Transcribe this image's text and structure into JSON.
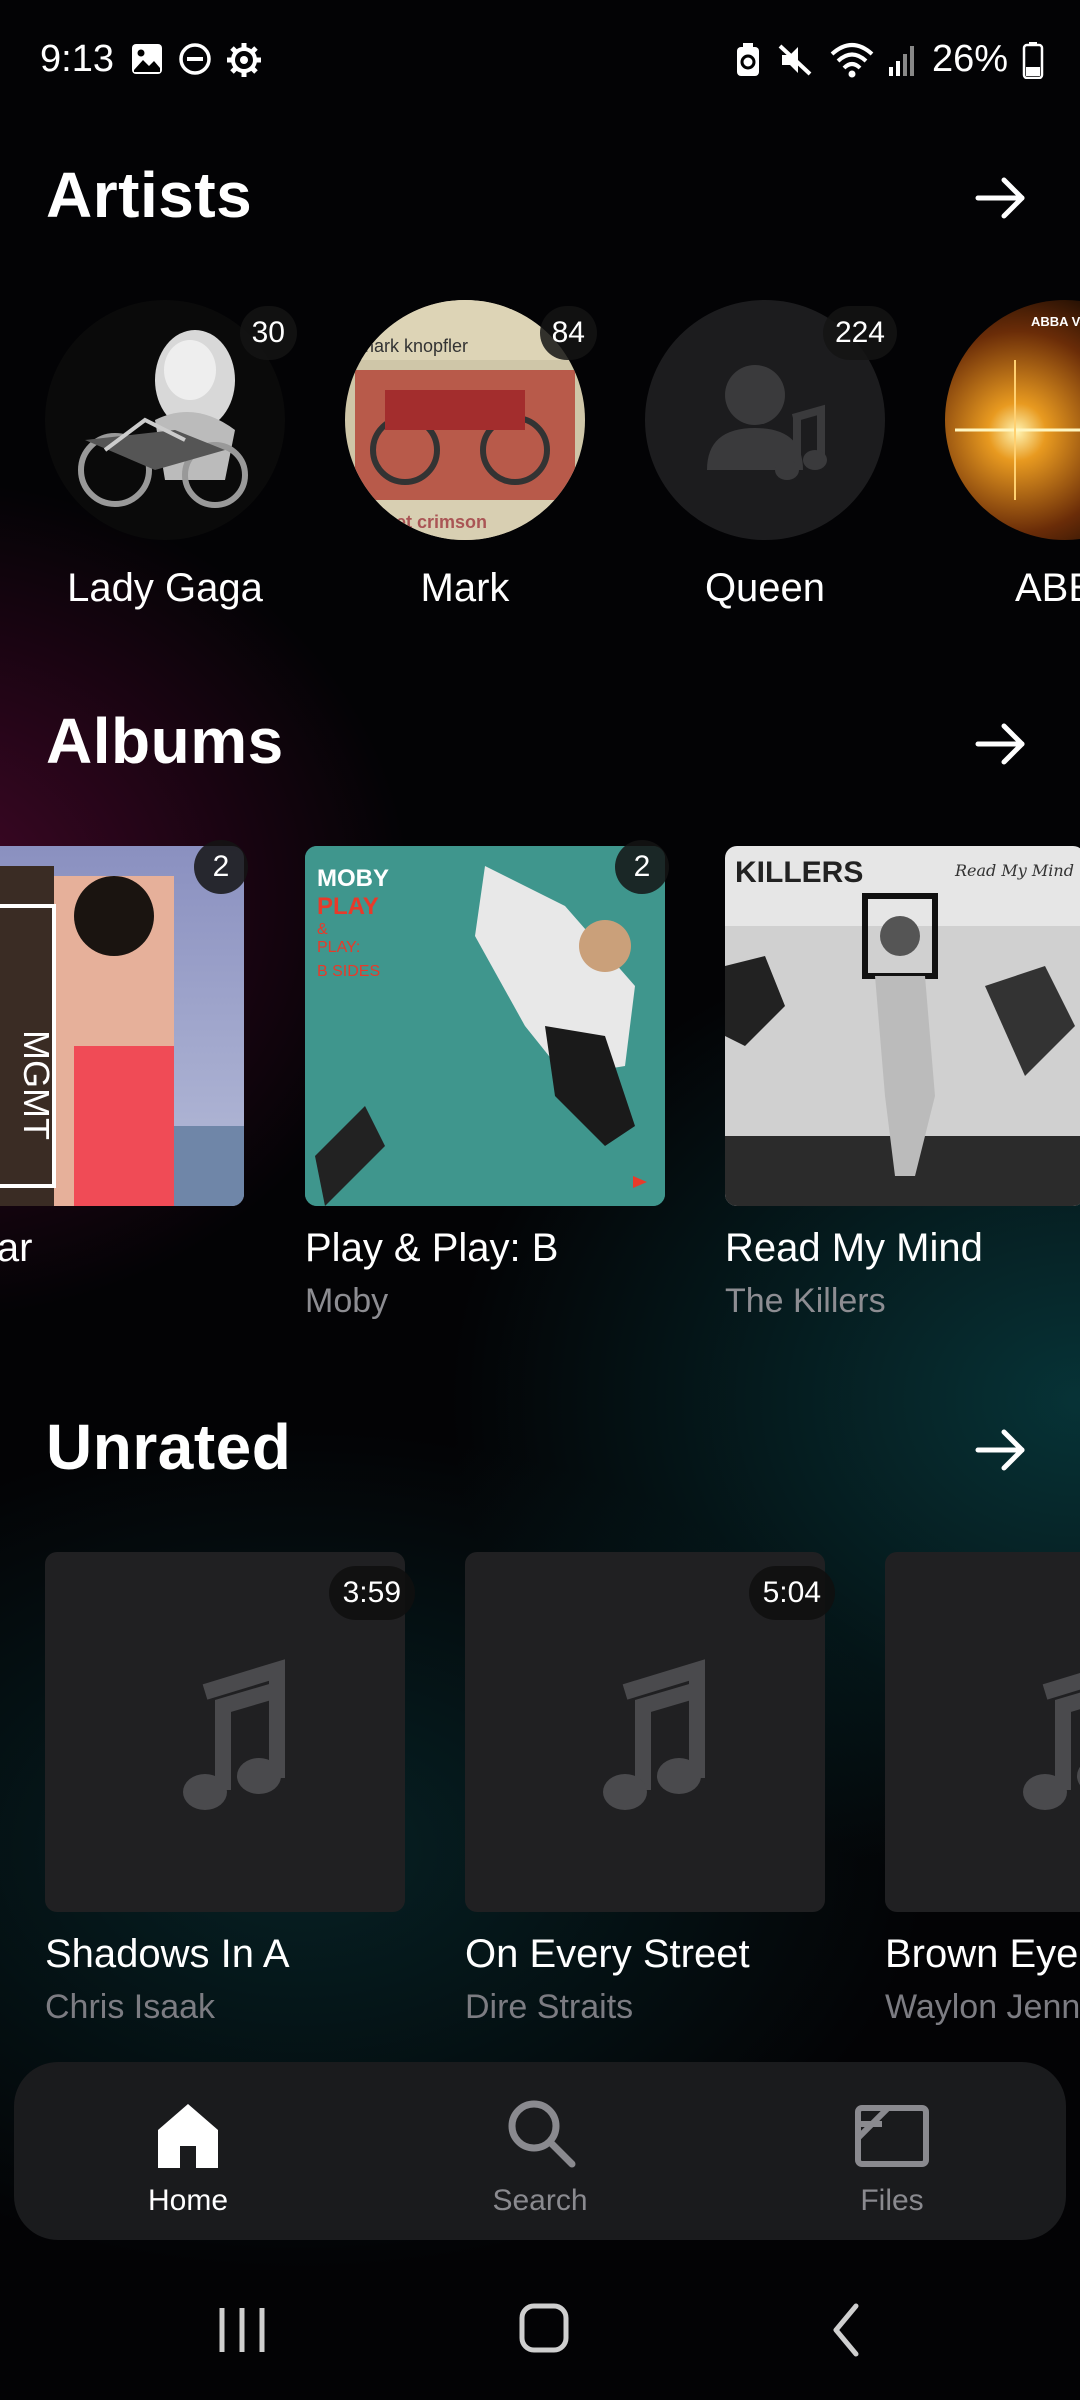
{
  "status_bar": {
    "time": "9:13",
    "battery": "26%",
    "left_icons": [
      "gallery-icon",
      "dnd-icon",
      "settings-gear-icon"
    ],
    "right_icons": [
      "battery-saver-icon",
      "mute-icon",
      "wifi-icon",
      "signal-icon",
      "battery-icon"
    ]
  },
  "artists": {
    "title": "Artists",
    "items": [
      {
        "name": "Lady Gaga",
        "count": "30"
      },
      {
        "name": "Mark",
        "count": "84"
      },
      {
        "name": "Queen",
        "count": "224"
      },
      {
        "name": "ABE",
        "count": ""
      }
    ]
  },
  "albums": {
    "title": "Albums",
    "items": [
      {
        "title": "lar",
        "artist": "",
        "count": "2"
      },
      {
        "title": "Play & Play: B",
        "artist": "Moby",
        "count": "2"
      },
      {
        "title": "Read My Mind",
        "artist": "The Killers",
        "count": ""
      }
    ],
    "art_text": {
      "moby_brand": "MOBY",
      "moby_play": "PLAY",
      "moby_amp": "&",
      "moby_play2": "PLAY:",
      "moby_bsides": "B SIDES",
      "killers_brand": "KILLERS",
      "killers_script": "Read My Mind",
      "mgmt": "MGMT"
    }
  },
  "unrated": {
    "title": "Unrated",
    "items": [
      {
        "title": "Shadows In A",
        "artist": "Chris Isaak",
        "duration": "3:59"
      },
      {
        "title": "On Every Street",
        "artist": "Dire Straits",
        "duration": "5:04"
      },
      {
        "title": "Brown Eye",
        "artist": "Waylon Jenn",
        "duration": ""
      }
    ]
  },
  "artist_art_text": {
    "knopfler": "mark knopfler",
    "crimson": "get crimson",
    "abba": "ABBA Voy"
  },
  "nav": {
    "home": "Home",
    "search": "Search",
    "files": "Files"
  },
  "colors": {
    "accent": "#ffffff",
    "muted": "#8d8d92",
    "nav_bg": "#1a1b1d"
  }
}
